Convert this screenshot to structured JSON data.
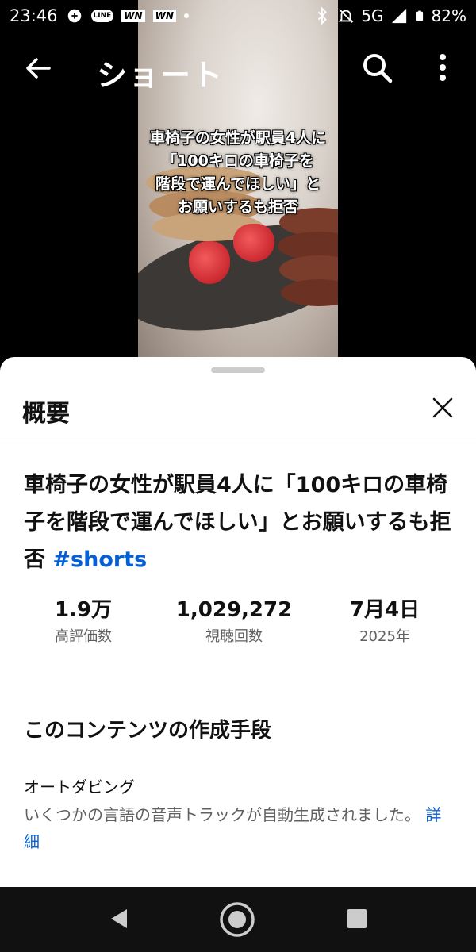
{
  "status_bar": {
    "time": "23:46",
    "line_badge": "LINE",
    "wn_badge_1": "WN",
    "wn_badge_2": "WN",
    "network": "5G",
    "battery": "82%"
  },
  "app_bar": {
    "title": "ショート"
  },
  "video": {
    "caption_lines": [
      "車椅子の女性が駅員4人に",
      "「100キロの車椅子を",
      "階段で運んでほしい」と",
      "お願いするも拒否"
    ]
  },
  "sheet": {
    "title": "概要",
    "video_title": "車椅子の女性が駅員4人に「100キロの車椅子を階段で運んでほしい」とお願いするも拒否",
    "hashtag": "#shorts",
    "stats": [
      {
        "value": "1.9万",
        "label": "高評価数"
      },
      {
        "value": "1,029,272",
        "label": "視聴回数"
      },
      {
        "value": "7月4日",
        "label": "2025年"
      }
    ],
    "section_title": "このコンテンツの作成手段",
    "auto_dub_label": "オートダビング",
    "auto_dub_desc": "いくつかの言語の音声トラックが自動生成されました。",
    "details_link": "詳細"
  },
  "colors": {
    "link": "#065fd4",
    "secondary_text": "#606060"
  }
}
